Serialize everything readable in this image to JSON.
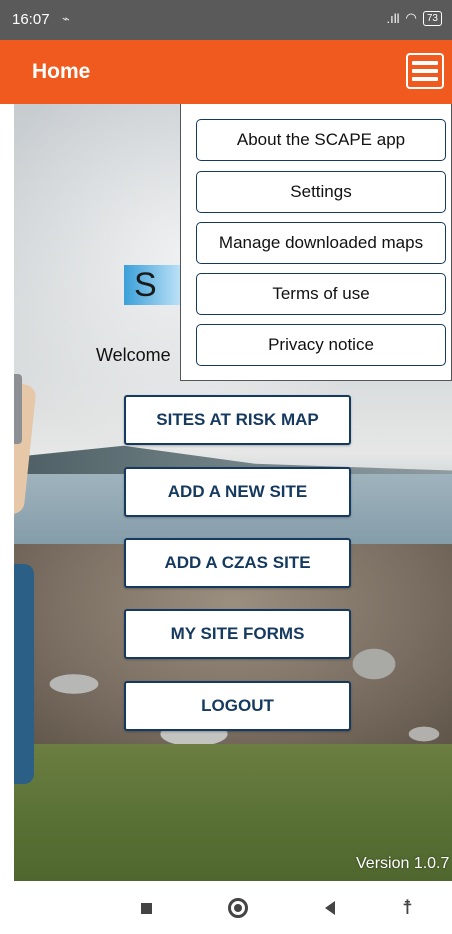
{
  "status_bar": {
    "time": "16:07",
    "battery": "73"
  },
  "app_bar": {
    "title": "Home"
  },
  "logo": {
    "letter": "S"
  },
  "welcome_text": "Welcome",
  "menu": {
    "items": [
      {
        "label": "About the SCAPE app"
      },
      {
        "label": "Settings"
      },
      {
        "label": "Manage downloaded maps"
      },
      {
        "label": "Terms of use"
      },
      {
        "label": "Privacy notice"
      }
    ]
  },
  "buttons": {
    "sites_at_risk_map": "SITES AT RISK MAP",
    "add_new_site": "ADD A NEW SITE",
    "add_czas_site": "ADD A CZAS SITE",
    "my_site_forms": "MY SITE FORMS",
    "logout": "LOGOUT"
  },
  "version": "Version 1.0.7",
  "colors": {
    "appbar": "#f05a1e",
    "button_border": "#163a5f"
  }
}
